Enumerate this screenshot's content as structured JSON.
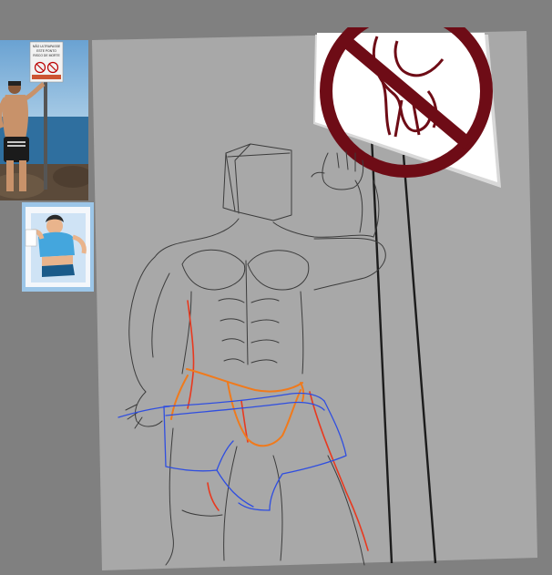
{
  "workspace": {
    "background_color": "#808080",
    "canvas_color": "#a8a8a8"
  },
  "references": [
    {
      "kind": "photo",
      "sign_lines": [
        "NÃO ULTRAPASSE",
        "ESTE PONTO",
        "RISCO DE MORTE"
      ],
      "colors": {
        "sky": "#7fb0d8",
        "sea": "#2f6f9f",
        "rocks": "#5b4a3a",
        "skin": "#c8926a",
        "shorts": "#1b1b1b"
      }
    },
    {
      "kind": "illustration",
      "colors": {
        "frame": "#9cc6e8",
        "shirt": "#44a6dd",
        "shorts": "#1a5b8a",
        "skin": "#e9b48c",
        "hair": "#2a2a2a"
      }
    }
  ],
  "prohibition_sign": {
    "symbol_color": "#6e0c16",
    "board_color": "#ffffff",
    "edge_color": "#d8d8d8"
  },
  "sketch": {
    "stroke_colors": {
      "pencil": "#3c3c3c",
      "red": "#e8391f",
      "orange": "#f07a1c",
      "blue": "#2f4ee0"
    }
  }
}
